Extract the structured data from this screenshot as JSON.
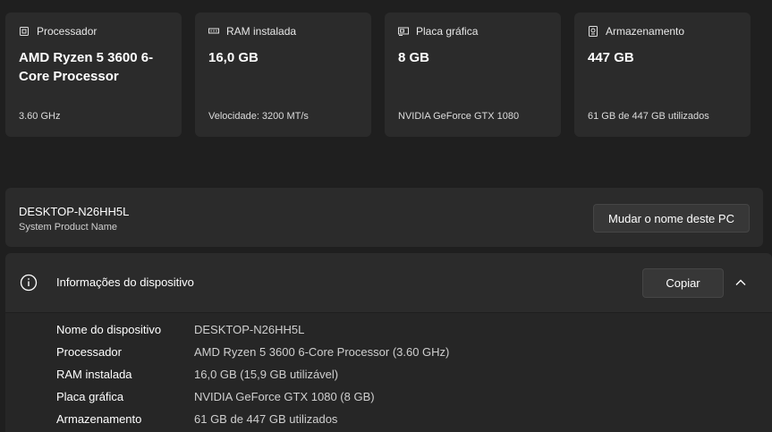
{
  "cards": [
    {
      "icon": "processor-icon",
      "label": "Processador",
      "value": "AMD Ryzen 5 3600 6-Core Processor",
      "sub": "3.60 GHz"
    },
    {
      "icon": "ram-icon",
      "label": "RAM instalada",
      "value": "16,0 GB",
      "sub": "Velocidade: 3200 MT/s"
    },
    {
      "icon": "gpu-icon",
      "label": "Placa gráfica",
      "value": "8 GB",
      "sub": "NVIDIA GeForce GTX 1080"
    },
    {
      "icon": "storage-icon",
      "label": "Armazenamento",
      "value": "447 GB",
      "sub": "61 GB de 447 GB utilizados"
    }
  ],
  "device": {
    "name": "DESKTOP-N26HH5L",
    "model": "System Product Name",
    "rename_label": "Mudar o nome deste PC"
  },
  "info": {
    "title": "Informações do dispositivo",
    "copy_label": "Copiar",
    "rows": [
      {
        "label": "Nome do dispositivo",
        "value": "DESKTOP-N26HH5L"
      },
      {
        "label": "Processador",
        "value": "AMD Ryzen 5 3600 6-Core Processor (3.60 GHz)"
      },
      {
        "label": "RAM instalada",
        "value": "16,0 GB (15,9 GB utilizável)"
      },
      {
        "label": "Placa gráfica",
        "value": "NVIDIA GeForce GTX 1080 (8 GB)"
      },
      {
        "label": "Armazenamento",
        "value": "61 GB de 447 GB utilizados"
      }
    ]
  }
}
